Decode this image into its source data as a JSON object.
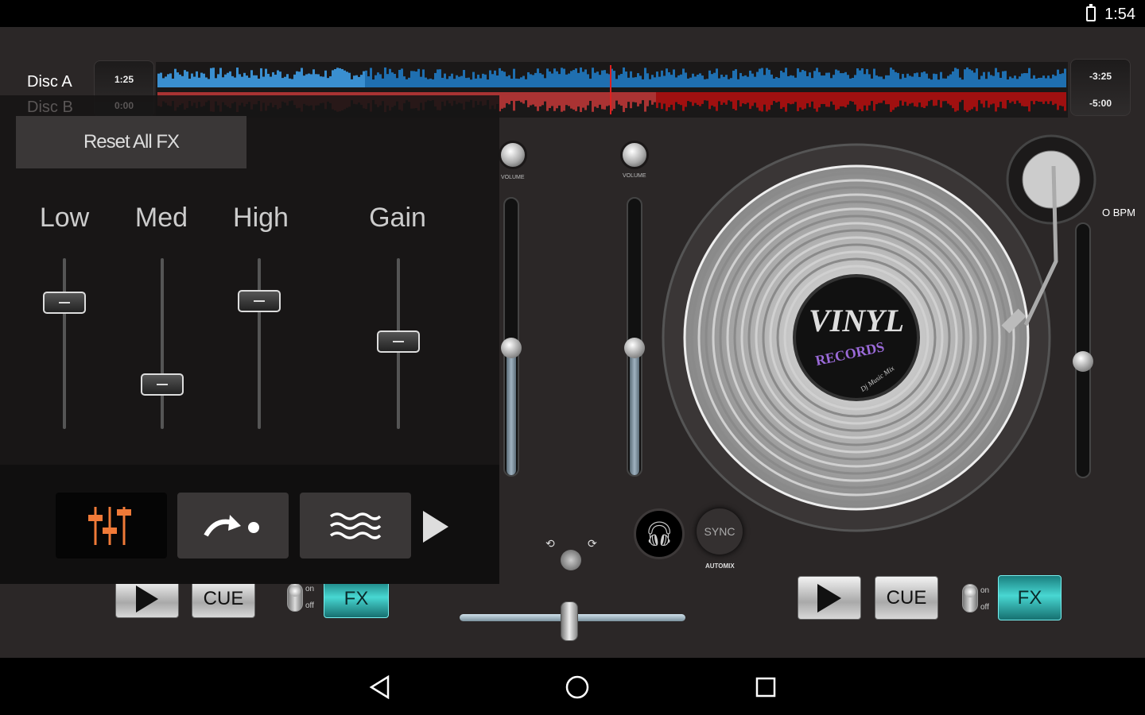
{
  "status_bar": {
    "time": "1:54",
    "battery_icon": "battery-charging-icon"
  },
  "deck_a": {
    "label": "Disc A",
    "elapsed": "1:25",
    "remaining": "-3:25",
    "play_icon": "play-icon",
    "cue_label": "CUE",
    "toggle_on": "on",
    "toggle_off": "off",
    "fx_label": "FX",
    "volume_label": "VOLUME",
    "volume_level": 0.47,
    "playback_position": 0.23
  },
  "deck_b": {
    "label": "Disc B",
    "elapsed": "0:00",
    "remaining": "-5:00",
    "play_icon": "play-icon",
    "cue_label": "CUE",
    "toggle_on": "on",
    "toggle_off": "off",
    "fx_label": "FX",
    "volume_label": "VOLUME",
    "volume_level": 0.47,
    "bpm": "O BPM",
    "pitch_level": 0.5,
    "playback_position": 0.55
  },
  "record_label": {
    "title": "VINYL",
    "subtitle": "RECORDS",
    "tagline": "Dj Music Mix"
  },
  "mixer": {
    "sync_label": "SYNC",
    "automix_label": "AUTOMIX",
    "crossfader_position": 0.49,
    "headphone_icon": "headphones-icon"
  },
  "colors": {
    "wave_a": "#3a8fd0",
    "wave_b": "#a01010",
    "fx_accent": "#3fcfcf",
    "eq_active": "#f07a38"
  },
  "fx_panel": {
    "reset_label": "Reset All FX",
    "bands": [
      {
        "label": "Low",
        "level": 0.74
      },
      {
        "label": "Med",
        "level": 0.26
      },
      {
        "label": "High",
        "level": 0.75
      },
      {
        "label": "Gain",
        "level": 0.51
      }
    ],
    "tabs": [
      {
        "icon": "equalizer-icon",
        "active": true
      },
      {
        "icon": "redo-dot-icon",
        "active": false
      },
      {
        "icon": "waves-icon",
        "active": false
      }
    ],
    "next_icon": "play-arrow-icon"
  },
  "nav_bar": {
    "back_icon": "back-icon",
    "home_icon": "home-icon",
    "recents_icon": "recents-icon"
  }
}
